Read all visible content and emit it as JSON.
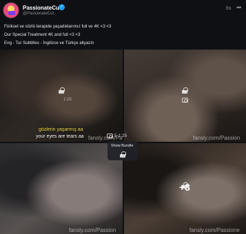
{
  "post": {
    "author_name": "PassionateCut",
    "verified_glyph": "✓",
    "handle": "@PassionateCut",
    "time_ago": "6s",
    "more_glyph": "•••",
    "caption_lines": [
      "Fiziksel ve sözlü terapide yaşadıklarımız full ve 4K <3 <3",
      "Our Special Treatment 4K and full <3 <3",
      "Eng - Tur Subtitles - İngilizce ve Türkçe altyazılı"
    ]
  },
  "media": {
    "tile1": {
      "count_text": "1:25",
      "subtitle_tr": "gözlerin yaşarmış aa",
      "subtitle_en": "your eyes are tears aa",
      "watermark": "fansly.com/Pa"
    },
    "tile2": {
      "watermark": "fansly.com/Passion"
    },
    "tile3": {
      "watermark": "fansly.com/Passion"
    },
    "tile4": {
      "watermark": "fansly.com/Passione",
      "more_count": "+3"
    },
    "stats_text": "5  1:25",
    "bundle_label": "Show Bundle"
  },
  "icons": [
    "verified-icon",
    "more-icon",
    "lock-icon",
    "camera-icon"
  ]
}
